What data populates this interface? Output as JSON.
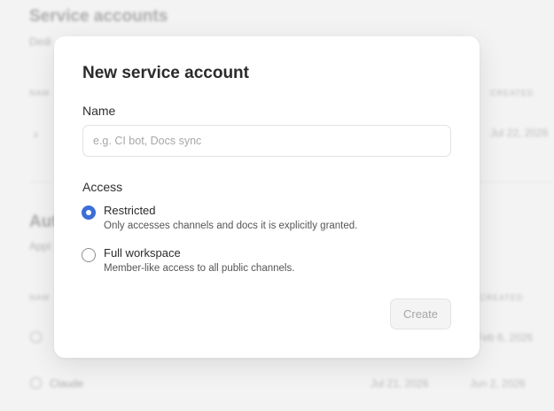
{
  "background": {
    "section1": {
      "title": "Service accounts",
      "subtitle": "Dedi",
      "col_name": "NAM",
      "col_created": "CREATED",
      "row_date": "Jul 22, 2026"
    },
    "section2": {
      "title": "Aut",
      "subtitle": "Appl",
      "col_name": "NAM",
      "col_created": "CREATED",
      "rows": [
        {
          "name": "",
          "date1": "",
          "date2": "Feb 6, 2026"
        },
        {
          "name": "Claude",
          "date1": "Jul 21, 2026",
          "date2": "Jun 2, 2026"
        }
      ]
    }
  },
  "modal": {
    "title": "New service account",
    "name_label": "Name",
    "name_placeholder": "e.g. CI bot, Docs sync",
    "name_value": "",
    "access_label": "Access",
    "options": [
      {
        "title": "Restricted",
        "description": "Only accesses channels and docs it is explicitly granted.",
        "selected": true
      },
      {
        "title": "Full workspace",
        "description": "Member-like access to all public channels.",
        "selected": false
      }
    ],
    "create_label": "Create"
  },
  "colors": {
    "accent": "#3b6fd8",
    "disabled_text": "#a6a6a6"
  }
}
